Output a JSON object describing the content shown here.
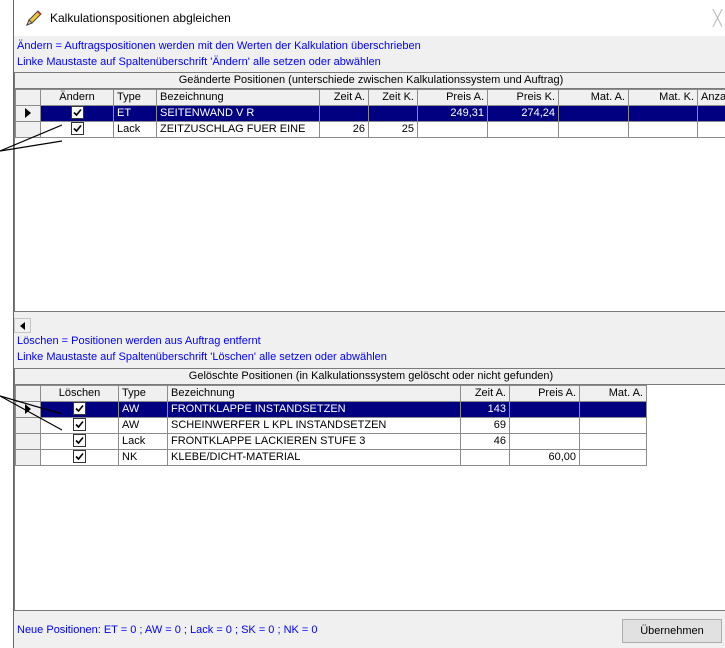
{
  "window": {
    "title": "Kalkulationspositionen abgleichen",
    "close_glyph": "╳"
  },
  "info": {
    "change_line1": "Ändern = Auftragspositionen werden mit den Werten der Kalkulation überschrieben",
    "change_line2": "Linke Maustaste auf Spaltenüberschrift 'Ändern' alle setzen oder abwählen",
    "delete_line1": "Löschen = Positionen werden aus Auftrag entfernt",
    "delete_line2": "Linke Maustaste auf Spaltenüberschrift 'Löschen' alle setzen oder abwählen"
  },
  "changed_grid": {
    "caption": "Geänderte Positionen (unterschiede zwischen Kalkulationssystem und Auftrag)",
    "columns": [
      "Ändern",
      "Type",
      "Bezeichnung",
      "Zeit A.",
      "Zeit K.",
      "Preis A.",
      "Preis K.",
      "Mat. A.",
      "Mat. K.",
      "Anza"
    ],
    "rows": [
      {
        "checked": true,
        "type": "ET",
        "bezeichnung": "SEITENWAND V R",
        "zeit_a": "",
        "zeit_k": "",
        "preis_a": "249,31",
        "preis_k": "274,24",
        "mat_a": "",
        "mat_k": "",
        "anz": ""
      },
      {
        "checked": true,
        "type": "Lack",
        "bezeichnung": "ZEITZUSCHLAG FUER EINE",
        "zeit_a": "26",
        "zeit_k": "25",
        "preis_a": "",
        "preis_k": "",
        "mat_a": "",
        "mat_k": "",
        "anz": ""
      }
    ]
  },
  "deleted_grid": {
    "caption": "Gelöschte Positionen (in Kalkulationssystem gelöscht oder nicht gefunden)",
    "columns": [
      "Löschen",
      "Type",
      "Bezeichnung",
      "Zeit A.",
      "Preis A.",
      "Mat. A."
    ],
    "rows": [
      {
        "checked": true,
        "type": "AW",
        "bezeichnung": "FRONTKLAPPE INSTANDSETZEN",
        "zeit_a": "143",
        "preis_a": "",
        "mat_a": ""
      },
      {
        "checked": true,
        "type": "AW",
        "bezeichnung": "SCHEINWERFER L KPL INSTANDSETZEN",
        "zeit_a": "69",
        "preis_a": "",
        "mat_a": ""
      },
      {
        "checked": true,
        "type": "Lack",
        "bezeichnung": "FRONTKLAPPE LACKIEREN STUFE 3",
        "zeit_a": "46",
        "preis_a": "",
        "mat_a": ""
      },
      {
        "checked": true,
        "type": "NK",
        "bezeichnung": "KLEBE/DICHT-MATERIAL",
        "zeit_a": "",
        "preis_a": "60,00",
        "mat_a": ""
      }
    ]
  },
  "status": "Neue Positionen: ET = 0 ; AW = 0 ; Lack = 0 ;  SK = 0 ;  NK = 0",
  "buttons": {
    "apply": "Übernehmen"
  },
  "icons": {
    "title": "pencil-icon",
    "row_pointer": "row-pointer-icon",
    "scroll_left": "scroll-left-arrow-icon"
  },
  "colors": {
    "selection": "#000080",
    "info_text": "#0000ff",
    "window_bg": "#f0f0f0"
  }
}
